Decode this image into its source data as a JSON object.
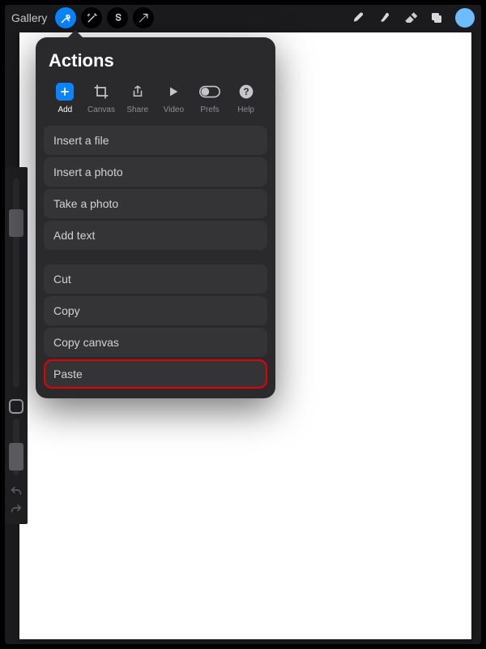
{
  "topbar": {
    "gallery": "Gallery"
  },
  "popover": {
    "title": "Actions",
    "tabs": {
      "add": "Add",
      "canvas": "Canvas",
      "share": "Share",
      "video": "Video",
      "prefs": "Prefs",
      "help": "Help"
    },
    "items_group1": [
      "Insert a file",
      "Insert a photo",
      "Take a photo",
      "Add text"
    ],
    "items_group2": [
      "Cut",
      "Copy",
      "Copy canvas",
      "Paste"
    ]
  }
}
